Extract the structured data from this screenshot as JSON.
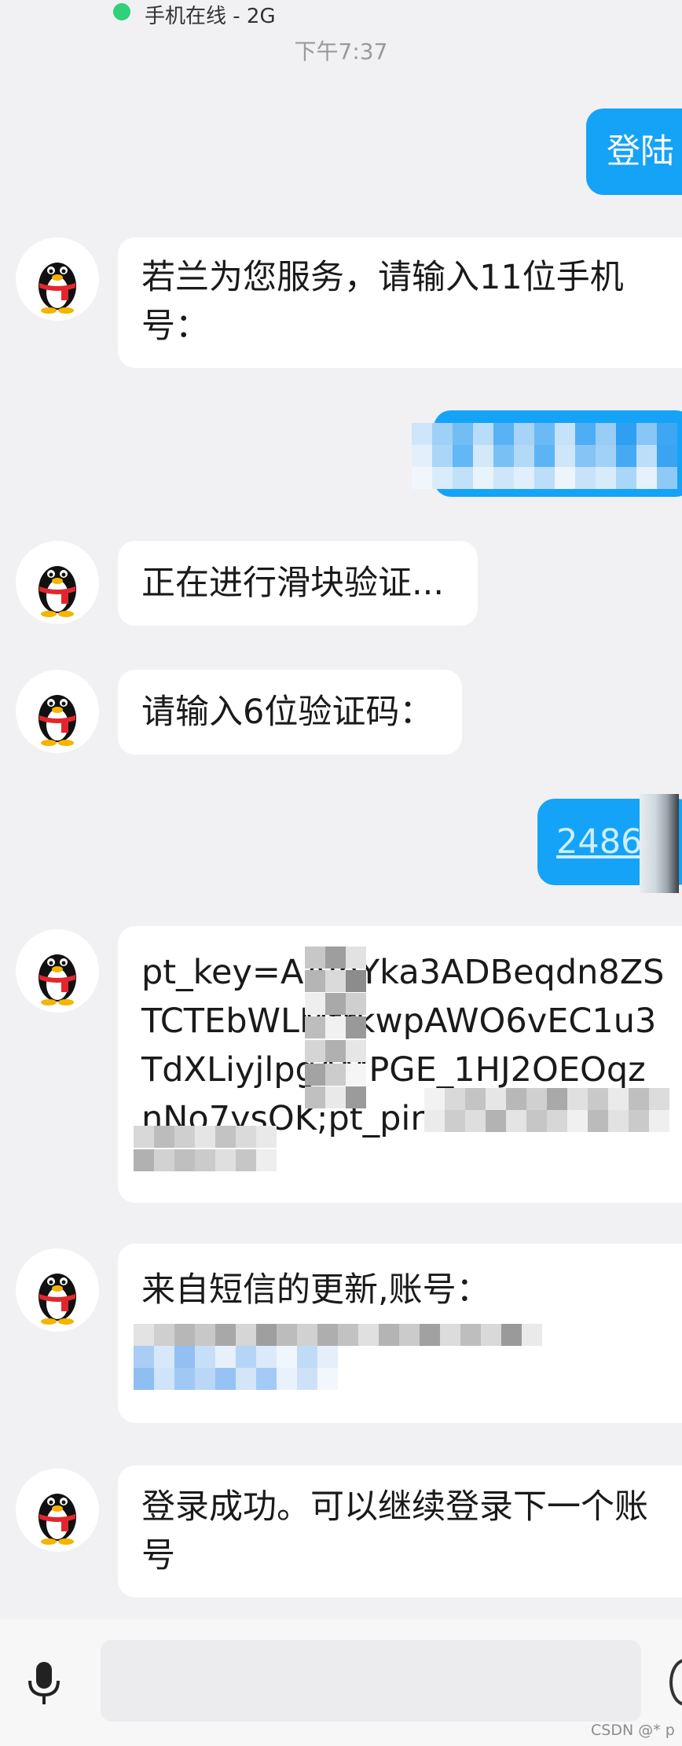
{
  "status": {
    "online_text": "手机在线 - 2G"
  },
  "time_label": "下午7:37",
  "messages": {
    "login": "登陆",
    "welcome_line1": "若兰为您服务，请输入11位手机",
    "welcome_line2": "号：",
    "slider": "正在进行滑块验证...",
    "code_prompt": "请输入6位验证码：",
    "code_reply": "24865",
    "pt_line1": "pt_key=AAJhYka3ADBeqdn8ZS",
    "pt_line2": "TCTEbWLMtrkwpAWO6vEC1u3",
    "pt_line3": "TdXLiyjlpgAMPGE_1HJ2OEOqz",
    "pt_line4": "nNo7ysOK;pt_pin=",
    "sms_line1": "来自短信的更新,账号：",
    "success_line1": "登录成功。可以继续登录下一个账",
    "success_line2": "号"
  },
  "watermark": "CSDN @* p",
  "icons": {
    "avatar": "qq-penguin-icon",
    "mic": "microphone-icon"
  },
  "colors": {
    "background": "#f1f1f3",
    "outgoing_bubble": "#15a3f7",
    "incoming_bubble": "#ffffff",
    "online": "#2fd17a"
  }
}
